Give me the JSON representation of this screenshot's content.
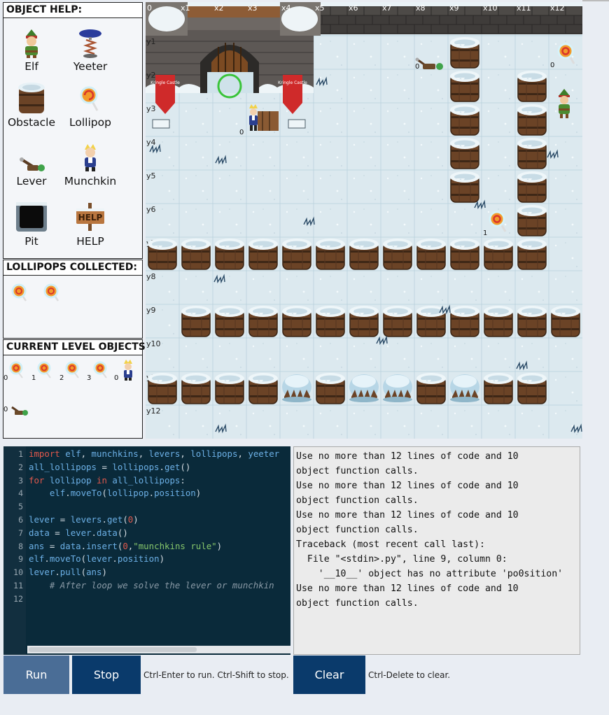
{
  "help_panel": {
    "title": "OBJECT HELP:",
    "items": [
      {
        "label": "Elf",
        "icon": "elf-icon"
      },
      {
        "label": "Yeeter",
        "icon": "yeeter-icon"
      },
      {
        "label": "Obstacle",
        "icon": "barrel-icon"
      },
      {
        "label": "Lollipop",
        "icon": "lollipop-icon"
      },
      {
        "label": "Lever",
        "icon": "lever-icon"
      },
      {
        "label": "Munchkin",
        "icon": "munchkin-icon"
      },
      {
        "label": "Pit",
        "icon": "pit-icon"
      },
      {
        "label": "HELP",
        "icon": "help-sign-icon"
      }
    ]
  },
  "collected_panel": {
    "title": "LOLLIPOPS COLLECTED:",
    "count_icons": 2
  },
  "current_panel": {
    "title": "CURRENT LEVEL OBJECTS:",
    "objects": [
      {
        "type": "lollipop",
        "index": "0"
      },
      {
        "type": "lollipop",
        "index": "1"
      },
      {
        "type": "lollipop",
        "index": "2"
      },
      {
        "type": "lollipop",
        "index": "3"
      },
      {
        "type": "munchkin",
        "index": "0"
      },
      {
        "type": "lever",
        "index": "0"
      }
    ]
  },
  "board": {
    "col_labels": [
      "0",
      "x1",
      "x2",
      "x3",
      "x4",
      "x5",
      "x6",
      "x7",
      "x8",
      "x9",
      "x10",
      "x11",
      "x12"
    ],
    "row_labels": [
      "y1",
      "y2",
      "y3",
      "y4",
      "y5",
      "y6",
      "y7",
      "y8",
      "y9",
      "y10",
      "y11",
      "y12"
    ],
    "castle_sign_text": "Kringle Castle",
    "object_indices": {
      "munchkin": "0",
      "lever": "0",
      "lollipop_top": "0",
      "lollipop_mid": "1"
    }
  },
  "editor": {
    "line_numbers": [
      "1",
      "2",
      "3",
      "4",
      "5",
      "6",
      "7",
      "8",
      "9",
      "10",
      "11",
      "12"
    ],
    "lines": [
      "import elf, munchkins, levers, lollipops, yeeter",
      "all_lollipops = lollipops.get()",
      "for lollipop in all_lollipops:",
      "    elf.moveTo(lollipop.position)",
      "",
      "lever = levers.get(0)",
      "data = lever.data()",
      "ans = data.insert(0,\"munchkins rule\")",
      "elf.moveTo(lever.position)",
      "lever.pull(ans)",
      "    # After loop we solve the lever or munchkin",
      ""
    ]
  },
  "output": {
    "text": "Use no more than 12 lines of code and 10\nobject function calls.\nUse no more than 12 lines of code and 10\nobject function calls.\nUse no more than 12 lines of code and 10\nobject function calls.\nTraceback (most recent call last):\n  File \"<stdin>.py\", line 9, column 0:\n    '__10__' object has no attribute 'po0sition'\nUse no more than 12 lines of code and 10\nobject function calls."
  },
  "controls": {
    "run_label": "Run",
    "stop_label": "Stop",
    "run_hint": "Ctrl-Enter to run. Ctrl-Shift to stop.",
    "clear_label": "Clear",
    "clear_hint": "Ctrl-Delete to clear."
  },
  "colors": {
    "editor_bg": "#0a2a3a",
    "button_dark": "#0a3a6b",
    "button_run": "#4a6d96",
    "snow": "#dde9ef",
    "keyword": "#e0584c",
    "string": "#86c66b"
  }
}
